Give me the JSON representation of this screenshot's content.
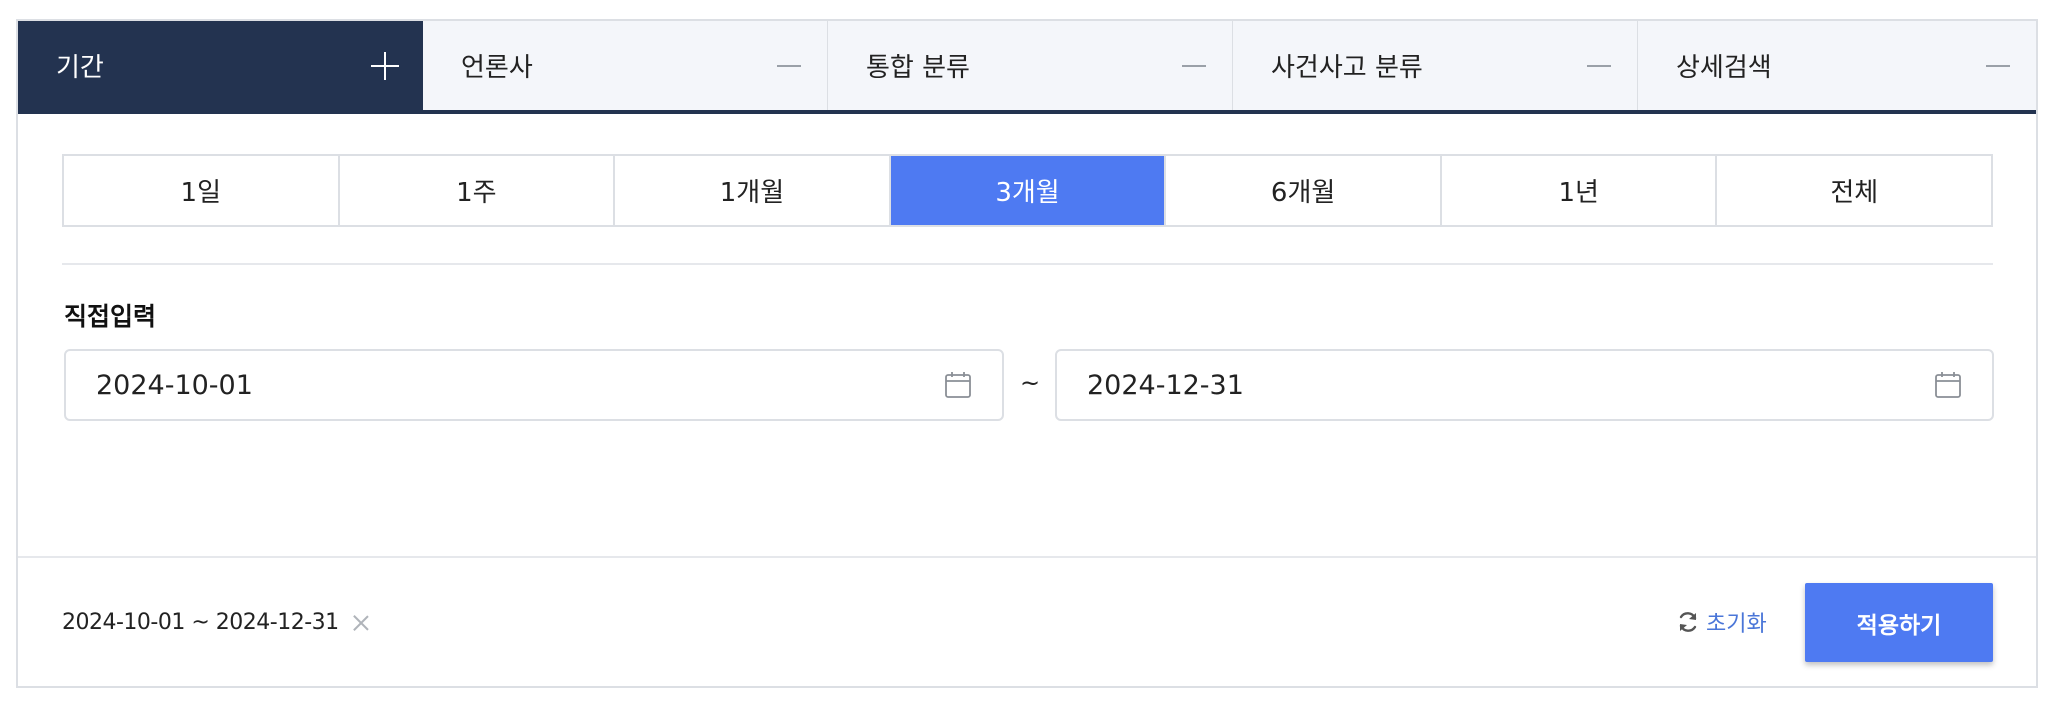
{
  "tabs": [
    {
      "label": "기간",
      "icon": "plus-icon",
      "active": true
    },
    {
      "label": "언론사",
      "icon": "minus-icon",
      "active": false
    },
    {
      "label": "통합 분류",
      "icon": "minus-icon",
      "active": false
    },
    {
      "label": "사건사고 분류",
      "icon": "minus-icon",
      "active": false
    },
    {
      "label": "상세검색",
      "icon": "minus-icon",
      "active": false
    }
  ],
  "periods": [
    {
      "label": "1일"
    },
    {
      "label": "1주"
    },
    {
      "label": "1개월"
    },
    {
      "label": "3개월",
      "selected": true
    },
    {
      "label": "6개월"
    },
    {
      "label": "1년"
    },
    {
      "label": "전체"
    }
  ],
  "direct_input": {
    "label": "직접입력",
    "start_date": "2024-10-01",
    "separator": "~",
    "end_date": "2024-12-31"
  },
  "footer": {
    "summary": "2024-10-01 ~ 2024-12-31",
    "reset_label": "초기화",
    "apply_label": "적용하기"
  },
  "colors": {
    "active_tab_bg": "#233350",
    "accent": "#4e7af2",
    "reset_text": "#4a76d8"
  }
}
